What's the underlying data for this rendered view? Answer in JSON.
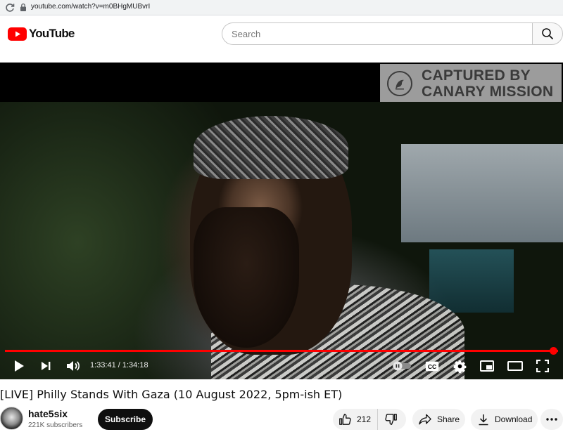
{
  "browser": {
    "url": "youtube.com/watch?v=m0BHgMUBvrI"
  },
  "header": {
    "logo_text": "YouTube",
    "search_placeholder": "Search"
  },
  "player": {
    "watermark_line1": "CAPTURED BY",
    "watermark_line2": "CANARY MISSION",
    "current_time": "1:33:41",
    "duration": "1:34:18",
    "time_display": "1:33:41 / 1:34:18",
    "progress_fraction": 0.993,
    "autoplay_on": false,
    "accent_color": "#ff0000"
  },
  "video": {
    "title": "[LIVE] Philly Stands With Gaza (10 August 2022, 5pm-ish ET)"
  },
  "channel": {
    "name": "hate5six",
    "subscribers": "221K subscribers",
    "subscribe_label": "Subscribe"
  },
  "actions": {
    "like_count": "212",
    "share_label": "Share",
    "download_label": "Download"
  },
  "icons": {
    "reload": "reload-icon",
    "lock": "lock-icon",
    "search": "search-icon",
    "play": "play-icon",
    "next": "next-icon",
    "volume": "volume-icon",
    "autoplay": "autoplay-toggle-icon",
    "captions": "captions-icon",
    "settings": "gear-icon",
    "miniplayer": "miniplayer-icon",
    "theater": "theater-icon",
    "fullscreen": "fullscreen-icon",
    "like": "thumbs-up-icon",
    "dislike": "thumbs-down-icon",
    "share": "share-icon",
    "download": "download-icon",
    "more": "more-icon"
  }
}
